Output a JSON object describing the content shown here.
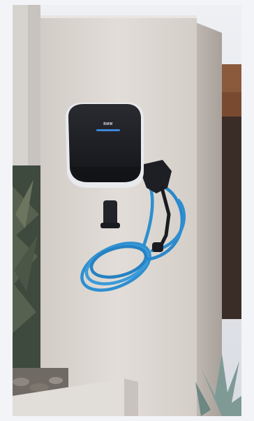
{
  "scene": {
    "subject": "wall-mounted-ev-charger",
    "brand_label": "BMW",
    "colors": {
      "background": "#f3f4f8",
      "pillar": "#dcd7d2",
      "charger_body": "#1c1d22",
      "charger_trim": "#e8eaee",
      "light_bar": "#3f86d8",
      "cable": "#2d8fd0",
      "plug": "#1e1f24",
      "sky": "#e9ecf1",
      "wood": "#7a4a30",
      "foliage": "#3f4a3e"
    },
    "icons": [
      "charger-icon",
      "plug-icon",
      "cable-icon",
      "holster-icon"
    ]
  }
}
